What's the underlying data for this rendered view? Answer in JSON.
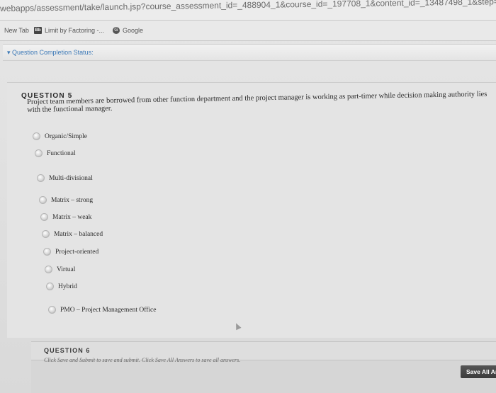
{
  "browser": {
    "url": "webapps/assessment/take/launch.jsp?course_assessment_id=_488904_1&course_id=_197708_1&content_id=_13487498_1&step=null",
    "bookmarks": [
      {
        "label": "New Tab",
        "icon": ""
      },
      {
        "label": "Limit by Factoring -...",
        "icon": "bb-icon"
      },
      {
        "label": "Google",
        "icon": "google-icon"
      }
    ]
  },
  "status": {
    "toggle_label": "Question Completion Status:"
  },
  "question": {
    "title": "QUESTION 5",
    "text": "Project team members are borrowed from other function department and the project manager is working as part-timer while decision making authority lies with the functional manager.",
    "options": [
      "Organic/Simple",
      "Functional",
      "Multi-divisional",
      "Matrix – strong",
      "Matrix – weak",
      "Matrix – balanced",
      "Project-oriented",
      "Virtual",
      "Hybrid",
      "PMO – Project Management Office"
    ]
  },
  "next_question": {
    "title": "QUESTION 6"
  },
  "footer": {
    "instructions": "Click Save and Submit to save and submit. Click Save All Answers to save all answers.",
    "save_all_label": "Save All Answers"
  }
}
